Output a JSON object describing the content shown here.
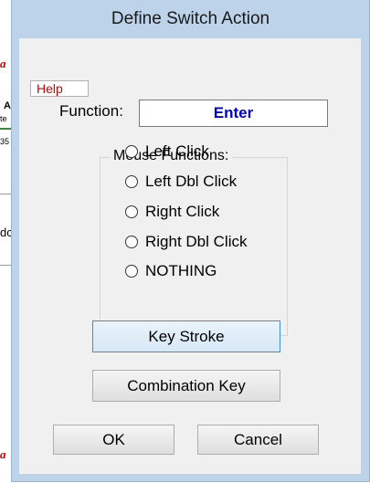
{
  "background": {
    "fragments": [
      "a",
      "A",
      "te",
      "35",
      "dc",
      "a"
    ]
  },
  "dialog": {
    "title": "Define Switch Action",
    "help_label": "Help",
    "function_label": "Function:",
    "function_value": "Enter",
    "mouse_group_title": "Mouse Functions:",
    "mouse_options": [
      "Left Click",
      "Left Dbl Click",
      "Right Click",
      "Right Dbl Click",
      "NOTHING"
    ],
    "key_stroke_label": "Key Stroke",
    "combination_key_label": "Combination Key",
    "ok_label": "OK",
    "cancel_label": "Cancel"
  },
  "colors": {
    "title_bar": "#bdd3ea",
    "function_text": "#0000cc",
    "help_text": "#d00000",
    "focus_border": "#3c8fd8"
  }
}
